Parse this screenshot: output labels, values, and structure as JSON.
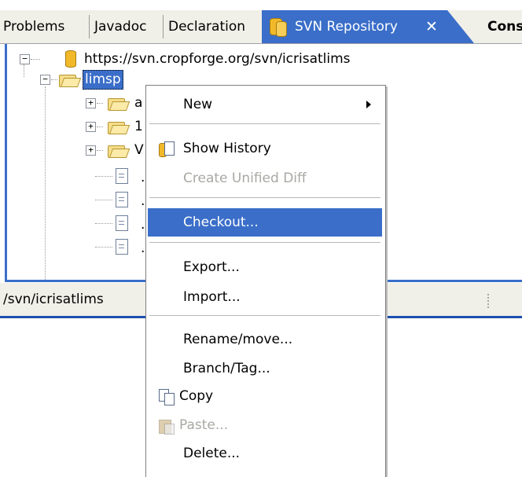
{
  "tabs": {
    "problems": "Problems",
    "javadoc": "Javadoc",
    "declaration": "Declaration",
    "svn_repository": "SVN Repository",
    "close": "✕",
    "console": "Cons"
  },
  "tree": {
    "root_url": "https://svn.cropforge.org/svn/icrisatlims",
    "selected_folder": "limsp",
    "child_folders": [
      "a",
      "1",
      "V"
    ],
    "child_files": [
      ".",
      ".",
      ".",
      "."
    ]
  },
  "status": {
    "path": "/svn/icrisatlims"
  },
  "context_menu": {
    "new": "New",
    "show_history": "Show History",
    "create_unified_diff": "Create Unified Diff",
    "checkout": "Checkout...",
    "export": "Export...",
    "import": "Import...",
    "rename_move": "Rename/move...",
    "branch_tag": "Branch/Tag...",
    "copy": "Copy",
    "paste": "Paste...",
    "delete": "Delete..."
  },
  "colors": {
    "selection": "#3a6ec9",
    "tab_bar": "#f0efe8",
    "disabled_text": "#a9a8a3"
  }
}
